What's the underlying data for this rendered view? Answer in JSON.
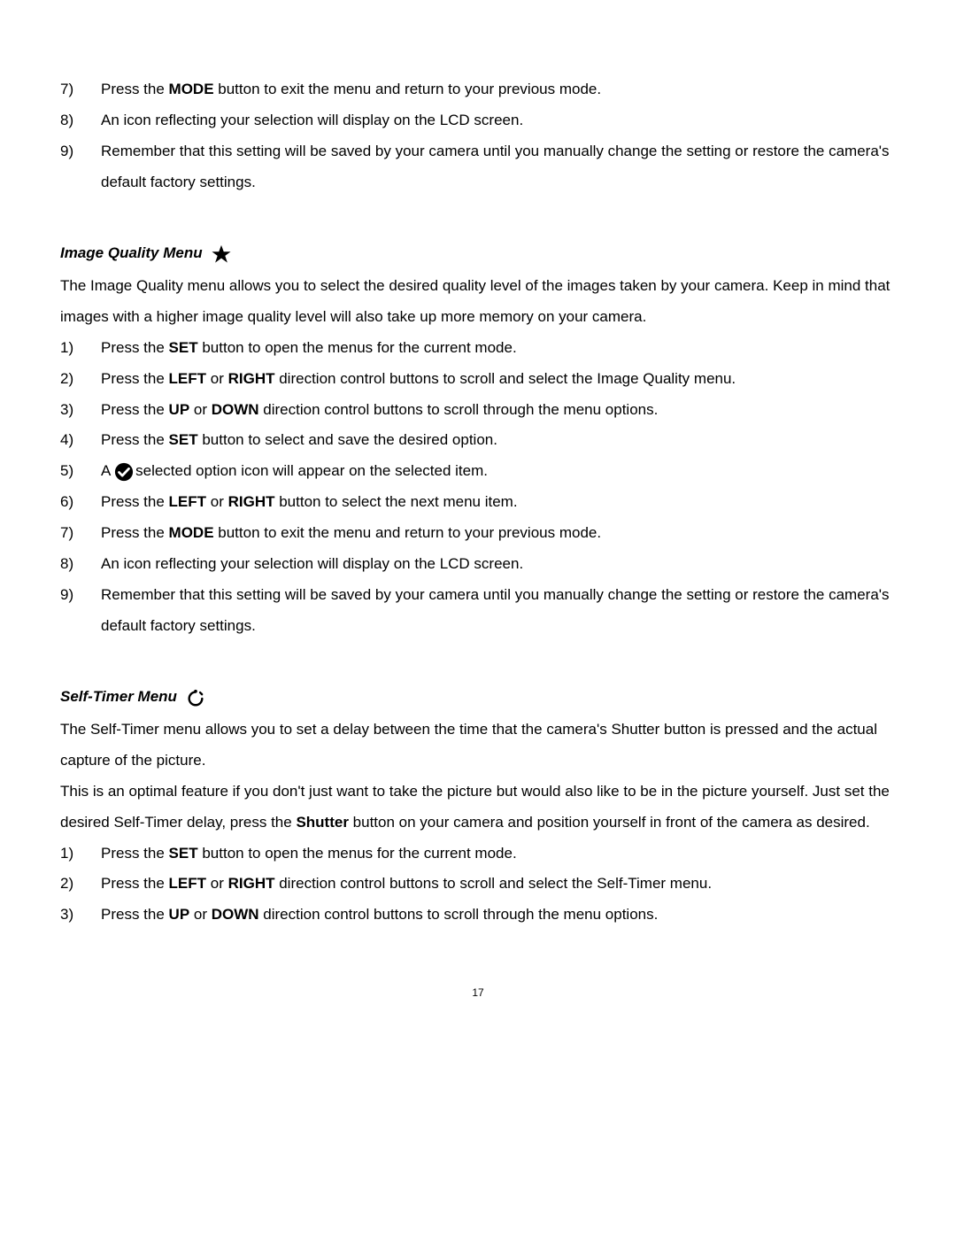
{
  "topList": {
    "items": [
      {
        "n": "7)",
        "pre": "Press the ",
        "bold": "MODE",
        "post": " button to exit the menu and return to your previous mode."
      },
      {
        "n": "8)",
        "text": "An icon reflecting your selection will display on the LCD screen."
      },
      {
        "n": "9)",
        "text": "Remember that this setting will be saved by your camera until you manually change the setting or restore the camera's default factory settings."
      }
    ]
  },
  "section1": {
    "heading": "Image Quality Menu",
    "intro": "The Image Quality menu allows you to select the desired quality level of the images taken by your camera. Keep in mind that images with a higher image quality level will also take up more memory on your camera.",
    "items": [
      {
        "n": "1)",
        "pre": "Press the ",
        "bold": "SET",
        "post": " button to open the menus for the current mode."
      },
      {
        "n": "2)",
        "pre": "Press the ",
        "bold": "LEFT",
        "mid": " or ",
        "bold2": "RIGHT",
        "post": " direction control buttons to scroll and select the Image Quality menu."
      },
      {
        "n": "3)",
        "pre": "Press the ",
        "bold": "UP",
        "mid": " or ",
        "bold2": "DOWN",
        "post": " direction control buttons to scroll through the menu options."
      },
      {
        "n": "4)",
        "pre": "Press the ",
        "bold": "SET",
        "post": " button to select and save the desired option."
      },
      {
        "n": "5)",
        "icon": true,
        "pre": "A ",
        "post": "selected option icon will appear on the selected item."
      },
      {
        "n": "6)",
        "pre": "Press the ",
        "bold": "LEFT",
        "mid": " or ",
        "bold2": "RIGHT",
        "post": " button to select the next menu item."
      },
      {
        "n": "7)",
        "pre": "Press the ",
        "bold": "MODE",
        "post": " button to exit the menu and return to your previous mode."
      },
      {
        "n": "8)",
        "text": "An icon reflecting your selection will display on the LCD screen."
      },
      {
        "n": "9)",
        "text": "Remember that this setting will be saved by your camera until you manually change the setting or restore the camera's default factory settings."
      }
    ]
  },
  "section2": {
    "heading": "Self-Timer Menu",
    "intro1": "The Self-Timer menu allows you to set a delay between the time that the camera's Shutter button is pressed and the actual capture of the picture.",
    "intro2a": "This is an optimal feature if you don't just want to take the picture but would also like to be in the picture yourself. Just set the desired Self-Timer delay, press the ",
    "intro2bold": "Shutter",
    "intro2b": " button on your camera and position yourself in front of the camera as desired.",
    "items": [
      {
        "n": "1)",
        "pre": "Press the ",
        "bold": "SET",
        "post": " button to open the menus for the current mode."
      },
      {
        "n": "2)",
        "pre": "Press the ",
        "bold": "LEFT",
        "mid": " or ",
        "bold2": "RIGHT",
        "post": " direction control buttons to scroll and select the Self-Timer menu."
      },
      {
        "n": "3)",
        "pre": "Press the ",
        "bold": "UP",
        "mid": " or ",
        "bold2": "DOWN",
        "post": " direction control buttons to scroll through the menu options."
      }
    ]
  },
  "pageNumber": "17"
}
